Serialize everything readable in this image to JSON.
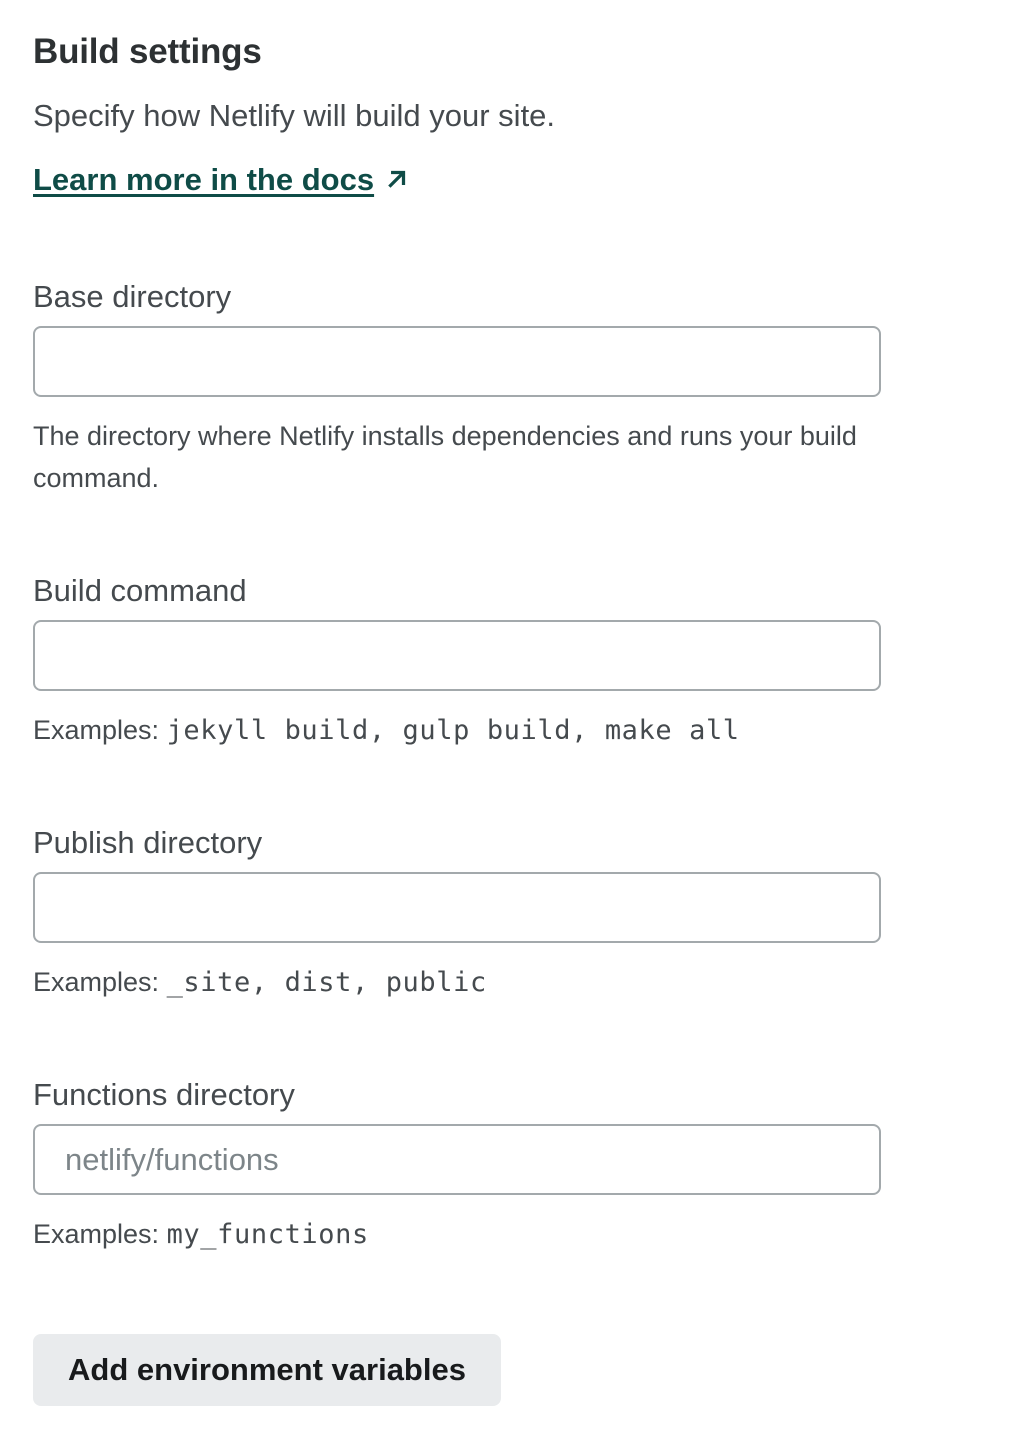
{
  "section": {
    "title": "Build settings",
    "subtitle": "Specify how Netlify will build your site.",
    "docs_link": "Learn more in the docs",
    "docs_link_icon": "external-arrow-icon"
  },
  "fields": {
    "base_directory": {
      "label": "Base directory",
      "value": "",
      "placeholder": "",
      "help": "The directory where Netlify installs dependencies and runs your build command."
    },
    "build_command": {
      "label": "Build command",
      "value": "",
      "placeholder": "",
      "help_prefix": "Examples:",
      "help_code": "jekyll build, gulp build, make all"
    },
    "publish_directory": {
      "label": "Publish directory",
      "value": "",
      "placeholder": "",
      "help_prefix": "Examples:",
      "help_code": "_site, dist, public"
    },
    "functions_directory": {
      "label": "Functions directory",
      "value": "",
      "placeholder": "netlify/functions",
      "help_prefix": "Examples:",
      "help_code": "my_functions"
    }
  },
  "actions": {
    "add_env_label": "Add environment variables"
  },
  "colors": {
    "link": "#0f4c47",
    "text": "#2d3133",
    "muted_text": "#454a4e",
    "input_border": "#a3a9ac",
    "button_bg": "#e9ebed"
  }
}
